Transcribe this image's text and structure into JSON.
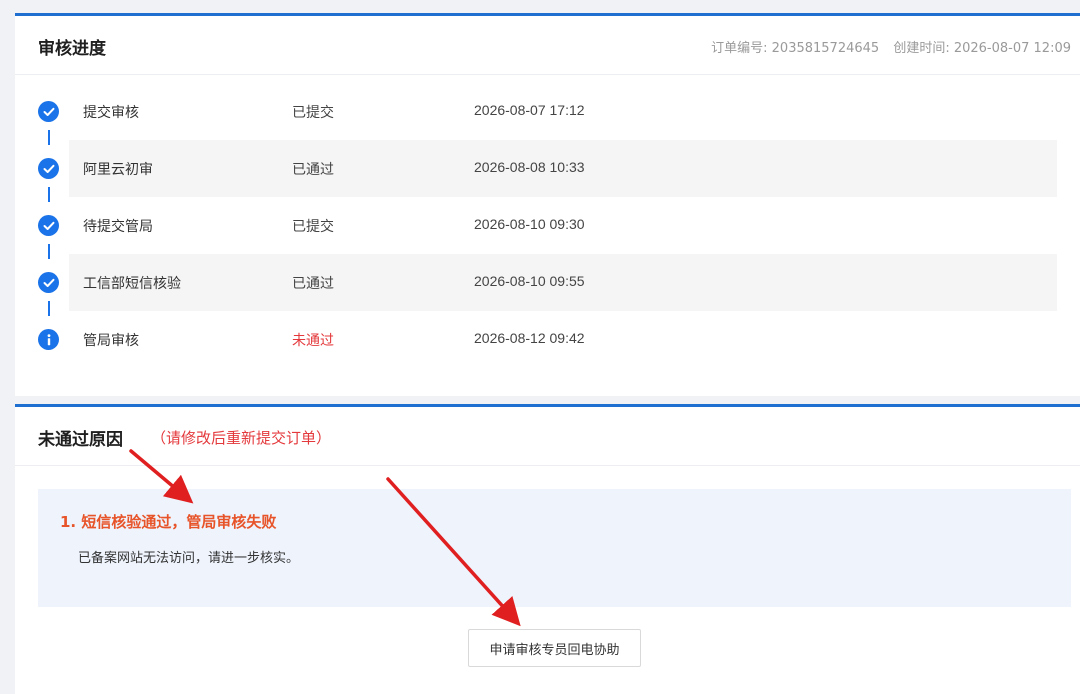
{
  "progress": {
    "title": "审核进度",
    "order_no": "订单编号: 2035815724645",
    "created": "创建时间: 2026-08-07 12:09",
    "steps": [
      {
        "name": "提交审核",
        "status": "已提交",
        "time": "2026-08-07 17:12",
        "icon": "check-circle-icon"
      },
      {
        "name": "阿里云初审",
        "status": "已通过",
        "time": "2026-08-08 10:33",
        "icon": "check-circle-icon"
      },
      {
        "name": "待提交管局",
        "status": "已提交",
        "time": "2026-08-10 09:30",
        "icon": "check-circle-icon"
      },
      {
        "name": "工信部短信核验",
        "status": "已通过",
        "time": "2026-08-10 09:55",
        "icon": "check-circle-icon"
      },
      {
        "name": "管局审核",
        "status": "未通过",
        "time": "2026-08-12 09:42",
        "icon": "info-circle-icon"
      }
    ]
  },
  "reason": {
    "title": "未通过原因",
    "hint": "（请修改后重新提交订单）",
    "item_title": "1. 短信核验通过，管局审核失败",
    "item_desc": "已备案网站无法访问，请进一步核实。",
    "button_label": "申请审核专员回电协助"
  },
  "colors": {
    "accent": "#1f6fd1",
    "icon_blue": "#1a73e8",
    "fail_red": "#e4393c",
    "annotation_red": "#e02020"
  }
}
